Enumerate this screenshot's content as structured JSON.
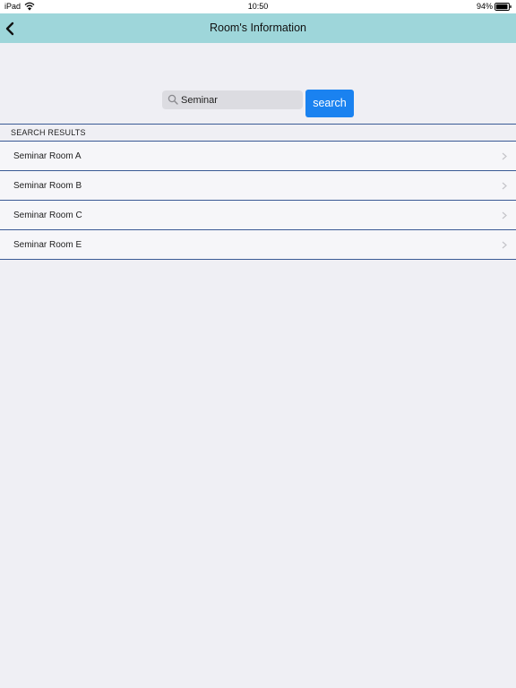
{
  "status_bar": {
    "device": "iPad",
    "time": "10:50",
    "battery_percent": "94%",
    "battery_level": 0.94
  },
  "nav": {
    "title": "Room's Information",
    "back_icon": "chevron-left-icon"
  },
  "search": {
    "value": "Seminar",
    "placeholder": "",
    "icon": "search-icon",
    "button_label": "search"
  },
  "results": {
    "header": "SEARCH RESULTS",
    "items": [
      {
        "label": "Seminar Room A"
      },
      {
        "label": "Seminar Room B"
      },
      {
        "label": "Seminar Room C"
      },
      {
        "label": "Seminar Room E"
      }
    ]
  },
  "colors": {
    "nav_background": "#9ed6da",
    "accent": "#1a82f0",
    "divider": "#3a5a95",
    "page_background": "#efeff4"
  }
}
